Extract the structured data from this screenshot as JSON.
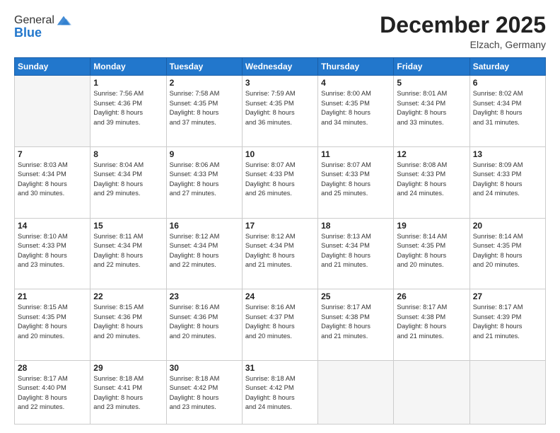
{
  "logo": {
    "general": "General",
    "blue": "Blue"
  },
  "title": "December 2025",
  "location": "Elzach, Germany",
  "days_header": [
    "Sunday",
    "Monday",
    "Tuesday",
    "Wednesday",
    "Thursday",
    "Friday",
    "Saturday"
  ],
  "weeks": [
    [
      {
        "day": "",
        "info": ""
      },
      {
        "day": "1",
        "info": "Sunrise: 7:56 AM\nSunset: 4:36 PM\nDaylight: 8 hours\nand 39 minutes."
      },
      {
        "day": "2",
        "info": "Sunrise: 7:58 AM\nSunset: 4:35 PM\nDaylight: 8 hours\nand 37 minutes."
      },
      {
        "day": "3",
        "info": "Sunrise: 7:59 AM\nSunset: 4:35 PM\nDaylight: 8 hours\nand 36 minutes."
      },
      {
        "day": "4",
        "info": "Sunrise: 8:00 AM\nSunset: 4:35 PM\nDaylight: 8 hours\nand 34 minutes."
      },
      {
        "day": "5",
        "info": "Sunrise: 8:01 AM\nSunset: 4:34 PM\nDaylight: 8 hours\nand 33 minutes."
      },
      {
        "day": "6",
        "info": "Sunrise: 8:02 AM\nSunset: 4:34 PM\nDaylight: 8 hours\nand 31 minutes."
      }
    ],
    [
      {
        "day": "7",
        "info": "Sunrise: 8:03 AM\nSunset: 4:34 PM\nDaylight: 8 hours\nand 30 minutes."
      },
      {
        "day": "8",
        "info": "Sunrise: 8:04 AM\nSunset: 4:34 PM\nDaylight: 8 hours\nand 29 minutes."
      },
      {
        "day": "9",
        "info": "Sunrise: 8:06 AM\nSunset: 4:33 PM\nDaylight: 8 hours\nand 27 minutes."
      },
      {
        "day": "10",
        "info": "Sunrise: 8:07 AM\nSunset: 4:33 PM\nDaylight: 8 hours\nand 26 minutes."
      },
      {
        "day": "11",
        "info": "Sunrise: 8:07 AM\nSunset: 4:33 PM\nDaylight: 8 hours\nand 25 minutes."
      },
      {
        "day": "12",
        "info": "Sunrise: 8:08 AM\nSunset: 4:33 PM\nDaylight: 8 hours\nand 24 minutes."
      },
      {
        "day": "13",
        "info": "Sunrise: 8:09 AM\nSunset: 4:33 PM\nDaylight: 8 hours\nand 24 minutes."
      }
    ],
    [
      {
        "day": "14",
        "info": "Sunrise: 8:10 AM\nSunset: 4:33 PM\nDaylight: 8 hours\nand 23 minutes."
      },
      {
        "day": "15",
        "info": "Sunrise: 8:11 AM\nSunset: 4:34 PM\nDaylight: 8 hours\nand 22 minutes."
      },
      {
        "day": "16",
        "info": "Sunrise: 8:12 AM\nSunset: 4:34 PM\nDaylight: 8 hours\nand 22 minutes."
      },
      {
        "day": "17",
        "info": "Sunrise: 8:12 AM\nSunset: 4:34 PM\nDaylight: 8 hours\nand 21 minutes."
      },
      {
        "day": "18",
        "info": "Sunrise: 8:13 AM\nSunset: 4:34 PM\nDaylight: 8 hours\nand 21 minutes."
      },
      {
        "day": "19",
        "info": "Sunrise: 8:14 AM\nSunset: 4:35 PM\nDaylight: 8 hours\nand 20 minutes."
      },
      {
        "day": "20",
        "info": "Sunrise: 8:14 AM\nSunset: 4:35 PM\nDaylight: 8 hours\nand 20 minutes."
      }
    ],
    [
      {
        "day": "21",
        "info": "Sunrise: 8:15 AM\nSunset: 4:35 PM\nDaylight: 8 hours\nand 20 minutes."
      },
      {
        "day": "22",
        "info": "Sunrise: 8:15 AM\nSunset: 4:36 PM\nDaylight: 8 hours\nand 20 minutes."
      },
      {
        "day": "23",
        "info": "Sunrise: 8:16 AM\nSunset: 4:36 PM\nDaylight: 8 hours\nand 20 minutes."
      },
      {
        "day": "24",
        "info": "Sunrise: 8:16 AM\nSunset: 4:37 PM\nDaylight: 8 hours\nand 20 minutes."
      },
      {
        "day": "25",
        "info": "Sunrise: 8:17 AM\nSunset: 4:38 PM\nDaylight: 8 hours\nand 21 minutes."
      },
      {
        "day": "26",
        "info": "Sunrise: 8:17 AM\nSunset: 4:38 PM\nDaylight: 8 hours\nand 21 minutes."
      },
      {
        "day": "27",
        "info": "Sunrise: 8:17 AM\nSunset: 4:39 PM\nDaylight: 8 hours\nand 21 minutes."
      }
    ],
    [
      {
        "day": "28",
        "info": "Sunrise: 8:17 AM\nSunset: 4:40 PM\nDaylight: 8 hours\nand 22 minutes."
      },
      {
        "day": "29",
        "info": "Sunrise: 8:18 AM\nSunset: 4:41 PM\nDaylight: 8 hours\nand 23 minutes."
      },
      {
        "day": "30",
        "info": "Sunrise: 8:18 AM\nSunset: 4:42 PM\nDaylight: 8 hours\nand 23 minutes."
      },
      {
        "day": "31",
        "info": "Sunrise: 8:18 AM\nSunset: 4:42 PM\nDaylight: 8 hours\nand 24 minutes."
      },
      {
        "day": "",
        "info": ""
      },
      {
        "day": "",
        "info": ""
      },
      {
        "day": "",
        "info": ""
      }
    ]
  ]
}
